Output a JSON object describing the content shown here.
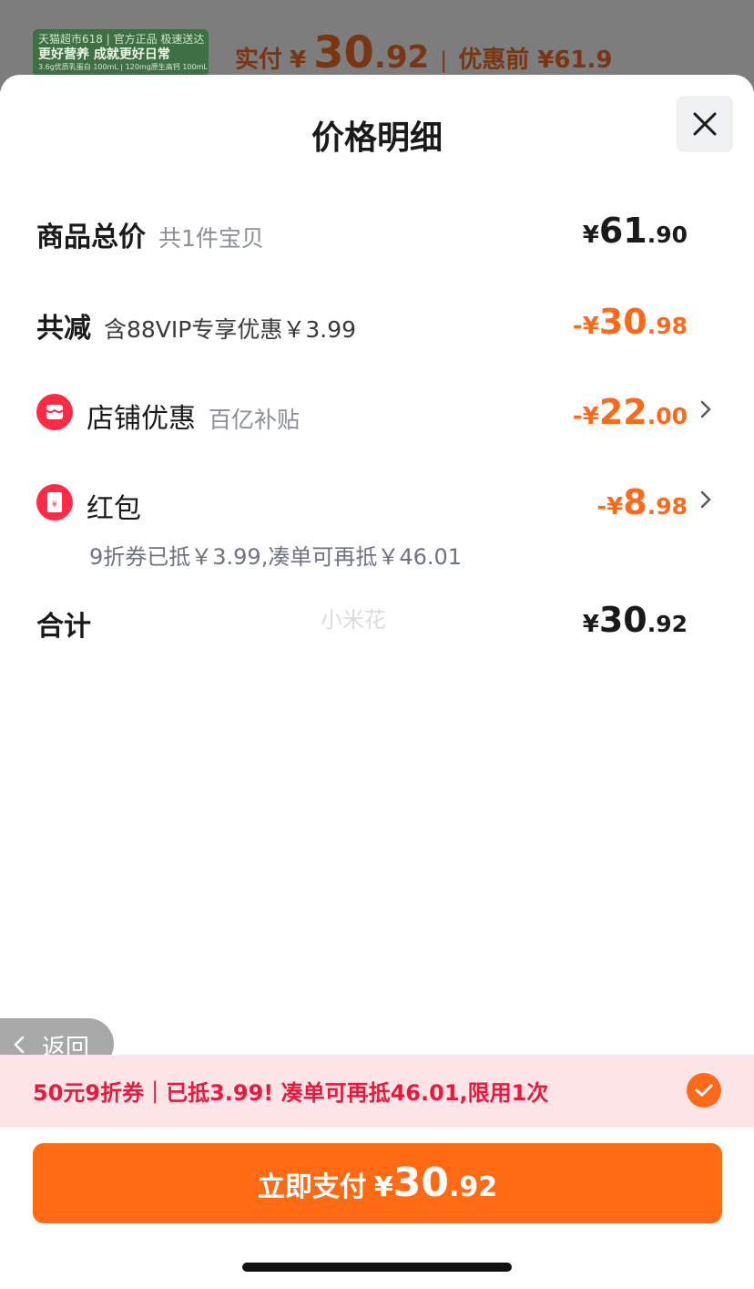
{
  "background": {
    "promo_thumb": {
      "line1": "天猫超市618 | 官方正品 极速送达",
      "line2": "更好营养 成就更好日常",
      "line3": "3.6g优质乳蛋白 100mL | 120mg原生高钙 100mL"
    },
    "paid_label": "实付",
    "paid_currency": "¥",
    "paid_int": "30",
    "paid_dec": ".92",
    "separator": "|",
    "before_discount": "优惠前 ¥61.9"
  },
  "sheet": {
    "title": "价格明细",
    "rows": {
      "subtotal": {
        "label": "商品总价",
        "sub": "共1件宝贝",
        "currency": "¥",
        "int": "61",
        "dec": ".90"
      },
      "reduction": {
        "label": "共减",
        "sub": "含88VIP专享优惠￥3.99",
        "currency": "-¥",
        "int": "30",
        "dec": ".98"
      },
      "store_discount": {
        "label": "店铺优惠",
        "sub": "百亿补贴",
        "currency": "-¥",
        "int": "22",
        "dec": ".00",
        "icon": "store-icon"
      },
      "red_packet": {
        "label": "红包",
        "note": "9折券已抵￥3.99,凑单可再抵￥46.01",
        "currency": "-¥",
        "int": "8",
        "dec": ".98",
        "icon": "red-packet-icon"
      },
      "total": {
        "label": "合计",
        "currency": "¥",
        "int": "30",
        "dec": ".92"
      }
    },
    "watermark": "小米花"
  },
  "back_pill": {
    "label": "返回"
  },
  "coupon": {
    "text": "50元9折券｜已抵3.99! 凑单可再抵46.01,限用1次",
    "checked": true
  },
  "pay_button": {
    "label": "立即支付",
    "currency": "¥",
    "int": "30",
    "dec": ".92"
  },
  "colors": {
    "accent_orange": "#ff6a12",
    "discount_orange": "#ff6a1a",
    "coupon_red": "#e8193c",
    "coupon_bg": "#fde4e6"
  }
}
